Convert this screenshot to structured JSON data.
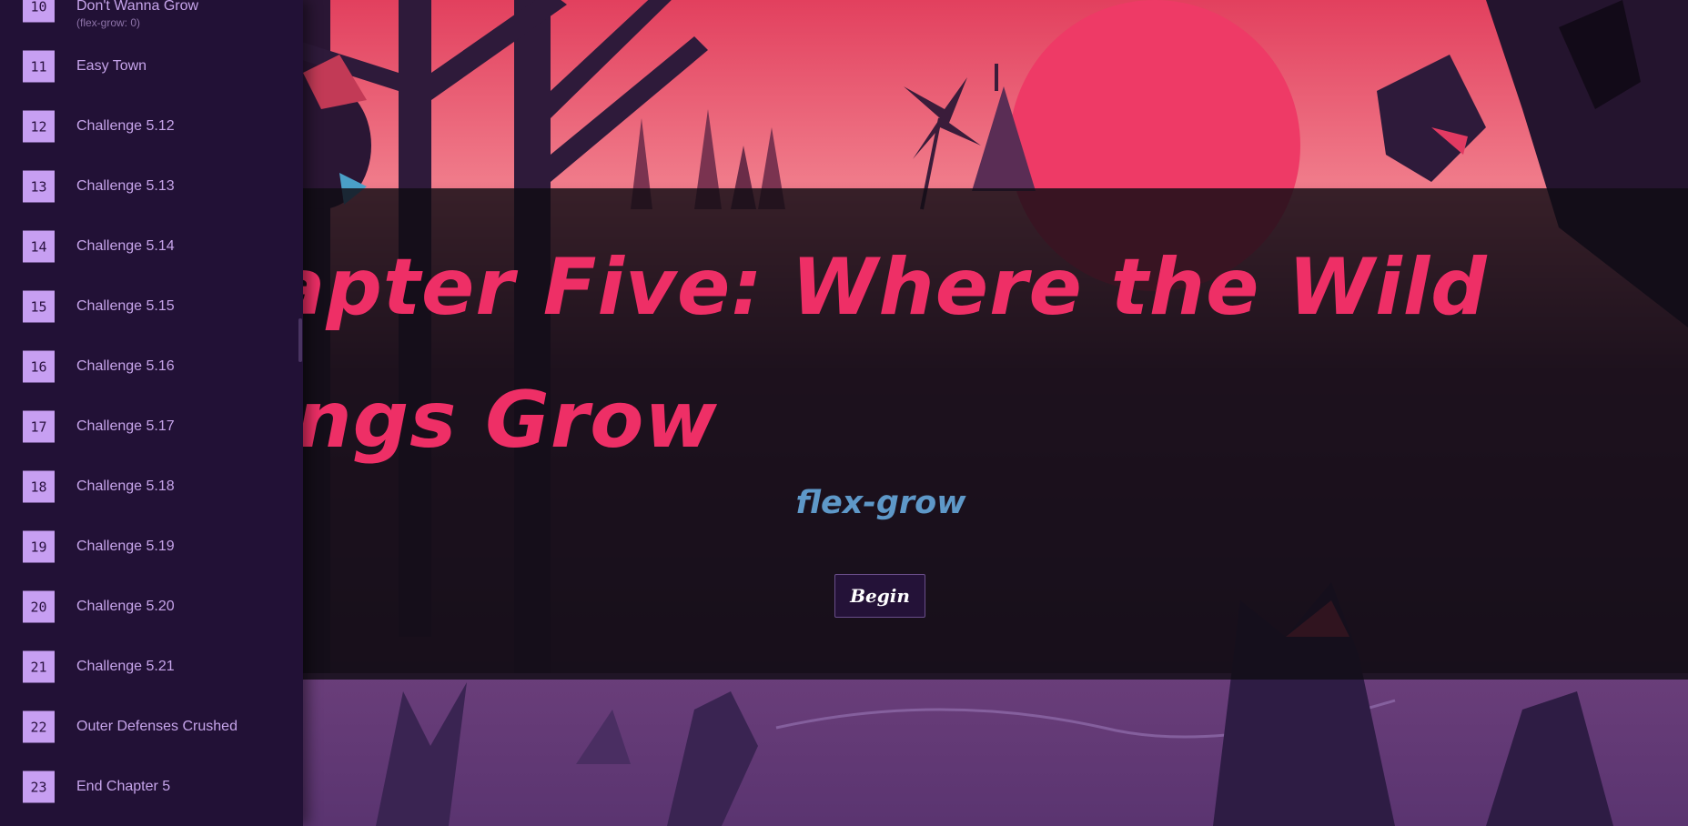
{
  "sidebar": {
    "levels": [
      {
        "num": "10",
        "label": "Don't Wanna Grow",
        "sub": "(flex-grow: 0)"
      },
      {
        "num": "11",
        "label": "Easy Town"
      },
      {
        "num": "12",
        "label": "Challenge 5.12"
      },
      {
        "num": "13",
        "label": "Challenge 5.13"
      },
      {
        "num": "14",
        "label": "Challenge 5.14"
      },
      {
        "num": "15",
        "label": "Challenge 5.15"
      },
      {
        "num": "16",
        "label": "Challenge 5.16"
      },
      {
        "num": "17",
        "label": "Challenge 5.17"
      },
      {
        "num": "18",
        "label": "Challenge 5.18"
      },
      {
        "num": "19",
        "label": "Challenge 5.19"
      },
      {
        "num": "20",
        "label": "Challenge 5.20"
      },
      {
        "num": "21",
        "label": "Challenge 5.21"
      },
      {
        "num": "22",
        "label": "Outer Defenses Crushed"
      },
      {
        "num": "23",
        "label": "End Chapter 5"
      }
    ]
  },
  "banner": {
    "title": "Chapter Five: Where the Wild Things Grow",
    "subtitle": "flex-grow",
    "begin_label": "Begin"
  },
  "colors": {
    "title": "#ee2f66",
    "subtitle": "#5e98c8",
    "sidebar_bg": "#221136",
    "level_badge": "#c79ff2",
    "level_text": "#c6a4ea"
  }
}
